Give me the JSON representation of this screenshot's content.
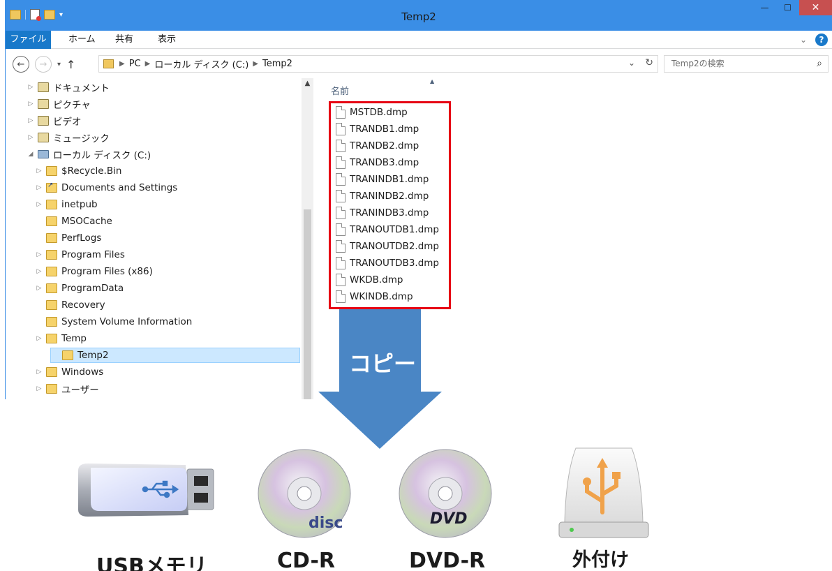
{
  "window": {
    "title": "Temp2",
    "controls": {
      "minimize": "—",
      "maximize": "☐",
      "close": "✕"
    }
  },
  "ribbon": {
    "tabs": [
      "ファイル",
      "ホーム",
      "共有",
      "表示"
    ],
    "help": "?"
  },
  "address": {
    "crumbs": [
      "PC",
      "ローカル ディスク (C:)",
      "Temp2"
    ],
    "search_placeholder": "Temp2の検索"
  },
  "nav_tree": [
    {
      "label": "ドキュメント",
      "icon": "library"
    },
    {
      "label": "ピクチャ",
      "icon": "library"
    },
    {
      "label": "ビデオ",
      "icon": "library"
    },
    {
      "label": "ミュージック",
      "icon": "library"
    },
    {
      "label": "ローカル ディスク (C:)",
      "icon": "drive"
    },
    {
      "label": "$Recycle.Bin",
      "icon": "folder"
    },
    {
      "label": "Documents and Settings",
      "icon": "link"
    },
    {
      "label": "inetpub",
      "icon": "folder"
    },
    {
      "label": "MSOCache",
      "icon": "folder"
    },
    {
      "label": "PerfLogs",
      "icon": "folder"
    },
    {
      "label": "Program Files",
      "icon": "folder"
    },
    {
      "label": "Program Files (x86)",
      "icon": "folder"
    },
    {
      "label": "ProgramData",
      "icon": "folder"
    },
    {
      "label": "Recovery",
      "icon": "folder"
    },
    {
      "label": "System Volume Information",
      "icon": "folder"
    },
    {
      "label": "Temp",
      "icon": "folder"
    },
    {
      "label": "Temp2",
      "icon": "folder",
      "selected": true
    },
    {
      "label": "Windows",
      "icon": "folder"
    },
    {
      "label": "ユーザー",
      "icon": "folder"
    }
  ],
  "content": {
    "column_name": "名前",
    "files": [
      "MSTDB.dmp",
      "TRANDB1.dmp",
      "TRANDB2.dmp",
      "TRANDB3.dmp",
      "TRANINDB1.dmp",
      "TRANINDB2.dmp",
      "TRANINDB3.dmp",
      "TRANOUTDB1.dmp",
      "TRANOUTDB2.dmp",
      "TRANOUTDB3.dmp",
      "WKDB.dmp",
      "WKINDB.dmp"
    ]
  },
  "arrow_label": "コピー",
  "devices": [
    {
      "label": "USBメモリ",
      "icon": "usb-stick-icon"
    },
    {
      "label": "CD-R",
      "icon": "cd-icon"
    },
    {
      "label": "DVD-R",
      "icon": "dvd-icon"
    },
    {
      "label": "外付け",
      "icon": "external-drive-icon"
    }
  ],
  "colors": {
    "titlebar": "#3a8ee6",
    "file_tab": "#1979ca",
    "highlight_box": "#e60012",
    "arrow": "#4a86c5",
    "selection": "#cce8ff"
  }
}
